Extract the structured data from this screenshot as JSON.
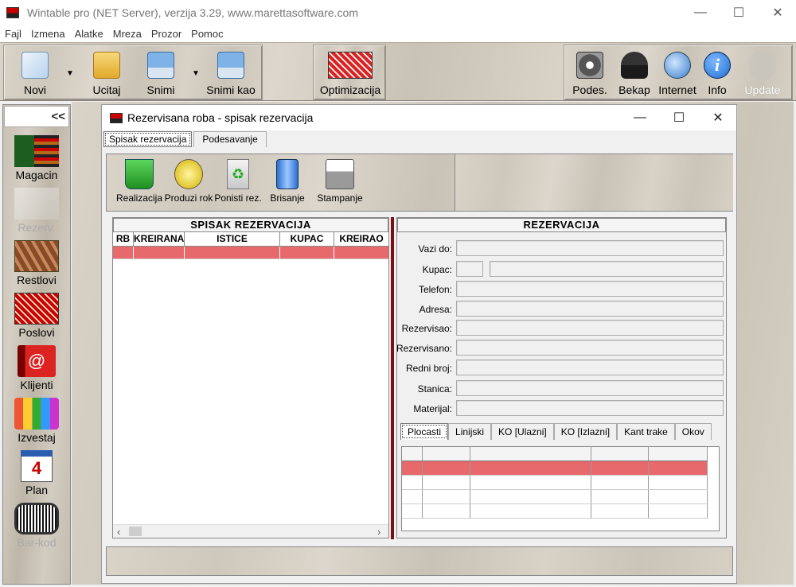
{
  "app": {
    "title": "Wintable pro (NET Server), verzija 3.29, www.marettasoftware.com"
  },
  "window_controls": {
    "minimize": "—",
    "maximize": "☐",
    "close": "✕"
  },
  "menu": [
    "Fajl",
    "Izmena",
    "Alatke",
    "Mreza",
    "Prozor",
    "Pomoc"
  ],
  "toolbar": {
    "novi": "Novi",
    "ucitaj": "Ucitaj",
    "snimi": "Snimi",
    "snimi_kao": "Snimi kao",
    "optimizacija": "Optimizacija",
    "podes": "Podes.",
    "bekap": "Bekap",
    "internet": "Internet",
    "info": "Info",
    "update": "Update",
    "drop_arrow": "▼"
  },
  "sidebar": {
    "collapse": "<<",
    "items": [
      "Magacin",
      "Rezerv.",
      "Restlovi",
      "Poslovi",
      "Klijenti",
      "Izvestaj",
      "Plan",
      "Bar-kod"
    ]
  },
  "child": {
    "title": "Rezervisana roba - spisak rezervacija",
    "tabs": [
      "Spisak rezervacija",
      "Podesavanje"
    ]
  },
  "inner_toolbar": {
    "realizacija": "Realizacija",
    "produzi": "Produzi rok",
    "ponisti": "Ponisti rez.",
    "brisanje": "Brisanje",
    "stampanje": "Stampanje"
  },
  "list": {
    "header": "SPISAK  REZERVACIJA",
    "columns": [
      "RB",
      "KREIRANA",
      "ISTICE",
      "KUPAC",
      "KREIRAO"
    ]
  },
  "form": {
    "header": "REZERVACIJA",
    "fields": [
      "Vazi do:",
      "Kupac:",
      "Telefon:",
      "Adresa:",
      "Rezervisao:",
      "Rezervisano:",
      "Redni broj:",
      "Stanica:",
      "Materijal:"
    ]
  },
  "detail_tabs": [
    "Plocasti",
    "Linijski",
    "KO [Ulazni]",
    "KO [Izlazni]",
    "Kant trake",
    "Okov"
  ],
  "scroll": {
    "left": "‹",
    "right": "›"
  },
  "colors": {
    "accent_row": "#e8696b",
    "divider": "#7a1010",
    "info_blue": "#1e6fd1"
  }
}
